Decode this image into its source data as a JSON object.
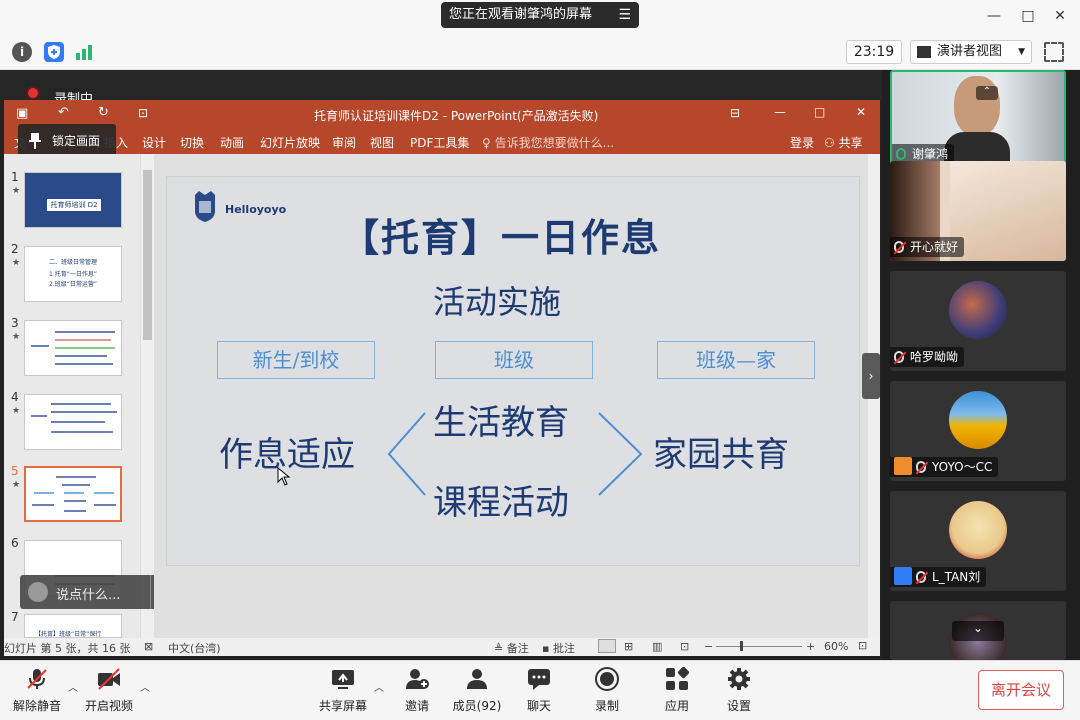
{
  "window": {
    "share_banner": "您正在观看谢肇鸿的屏幕",
    "minimize": "—",
    "maximize": "□",
    "close": "✕"
  },
  "infobar": {
    "clock": "23:19",
    "view_mode": "演讲者视图"
  },
  "recording": {
    "label": "录制中"
  },
  "ppt": {
    "title": "托育师认证培训课件D2 - PowerPoint(产品激活失败)",
    "ribbon_tabs": [
      "文",
      "插入",
      "设计",
      "切换",
      "动画",
      "幻灯片放映",
      "审阅",
      "视图",
      "PDF工具集"
    ],
    "tell_me": "告诉我您想要做什么...",
    "login": "登录",
    "share": "共享",
    "lock_screen": "锁定画面",
    "comment_placeholder": "说点什么...",
    "thumb_numbers": [
      "1",
      "2",
      "3",
      "4",
      "5",
      "6",
      "7"
    ],
    "thumb_texts": {
      "t1": "托育师培训 D2",
      "t2a": "二、班级日常管理",
      "t2b": "1.托育“一日作息”",
      "t2c": "2.班级“日常运营”",
      "t7": "【托育】班级“日常”保行"
    },
    "status": {
      "slide_info": "幻灯片 第 5 张，共 16 张",
      "language": "中文(台湾)",
      "notes": "备注",
      "comments": "批注",
      "zoom": "60%"
    }
  },
  "slide": {
    "logo_text": "Helloyoyo",
    "title": "【托育】一日作息",
    "subtitle": "活动实施",
    "boxes": [
      "新生/到校",
      "班级",
      "班级—家"
    ],
    "left": "作息适应",
    "middle_top": "生活教育",
    "middle_bottom": "课程活动",
    "right": "家园共育"
  },
  "participants": [
    {
      "name": "谢肇鸿",
      "mic": "on",
      "speaking": true
    },
    {
      "name": "开心就好",
      "mic": "off"
    },
    {
      "name": "哈罗呦呦",
      "mic": "off"
    },
    {
      "name": "YOYO～CC",
      "mic": "off"
    },
    {
      "name": "L_TAN刘",
      "mic": "off"
    },
    {
      "name": "",
      "mic": "off"
    }
  ],
  "toolbar": {
    "unmute": "解除静音",
    "start_video": "开启视频",
    "share_screen": "共享屏幕",
    "invite": "邀请",
    "members": "成员(92)",
    "chat": "聊天",
    "record": "录制",
    "apps": "应用",
    "settings": "设置",
    "leave": "离开会议"
  },
  "colors": {
    "ppt_red": "#b7472a",
    "slide_blue": "#1d3a72",
    "box_blue": "#4b8fd2",
    "speaking_green": "#2bb673",
    "leave_red": "#e04343"
  }
}
